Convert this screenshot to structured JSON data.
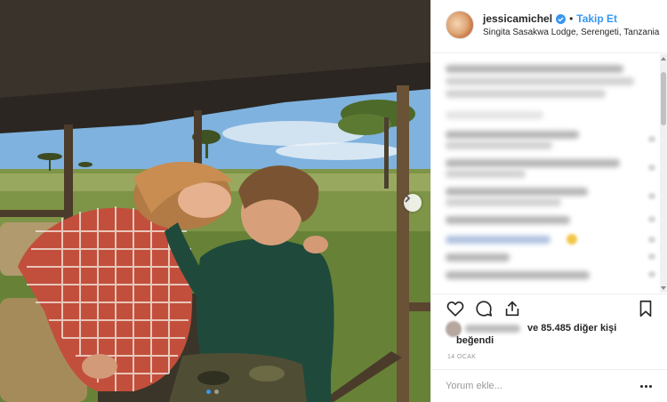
{
  "post": {
    "image_alt": "Couple kissing in a safari vehicle in the Serengeti",
    "carousel_total": 2,
    "carousel_active": 1
  },
  "header": {
    "username": "jessicamichel",
    "separator": "•",
    "follow_label": "Takip Et",
    "location": "Singita Sasakwa Lodge, Serengeti, Tanzania"
  },
  "likes": {
    "count_text": "ve 85.485 diğer kişi",
    "suffix": "beğendi"
  },
  "date": "14 OCAK",
  "comment_box": {
    "placeholder": "Yorum ekle..."
  },
  "colors": {
    "accent": "#3897f0",
    "text": "#262626",
    "muted": "#999999"
  },
  "icons": [
    "verified-badge-icon",
    "heart-icon",
    "comment-icon",
    "share-icon",
    "bookmark-icon",
    "more-options-icon",
    "chevron-right-icon"
  ]
}
